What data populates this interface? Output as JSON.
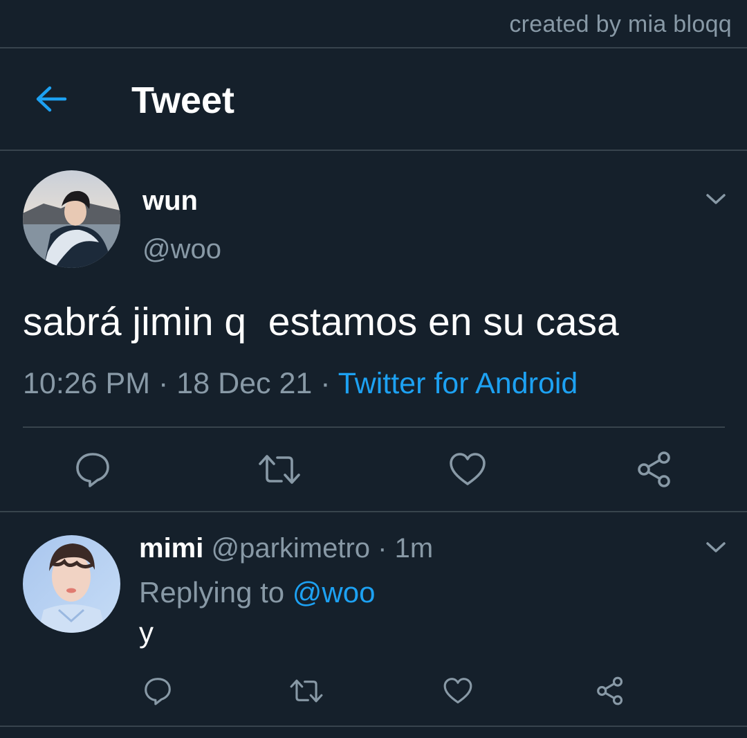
{
  "credit": "created by mia bloqq",
  "header": {
    "title": "Tweet",
    "back_icon": "arrow-left-icon"
  },
  "main_tweet": {
    "display_name": "wun",
    "handle": "@woo",
    "text": "sabrá jimin q  estamos en su casa",
    "time": "10:26 PM",
    "separator": "·",
    "date": "18 Dec 21",
    "source": "Twitter for Android",
    "menu_icon": "chevron-down-icon",
    "actions": [
      "reply-icon",
      "retweet-icon",
      "like-icon",
      "share-icon"
    ]
  },
  "reply_tweet": {
    "display_name": "mimi",
    "handle": "@parkimetro",
    "separator": "·",
    "age": "1m",
    "replying_to_label": "Replying to",
    "replying_to_handle": "@woo",
    "text": "y",
    "menu_icon": "chevron-down-icon",
    "actions": [
      "reply-icon",
      "retweet-icon",
      "like-icon",
      "share-icon"
    ]
  },
  "colors": {
    "background": "#15202b",
    "divider": "#38444d",
    "muted": "#8899a6",
    "accent": "#1da1f2",
    "text": "#ffffff"
  }
}
